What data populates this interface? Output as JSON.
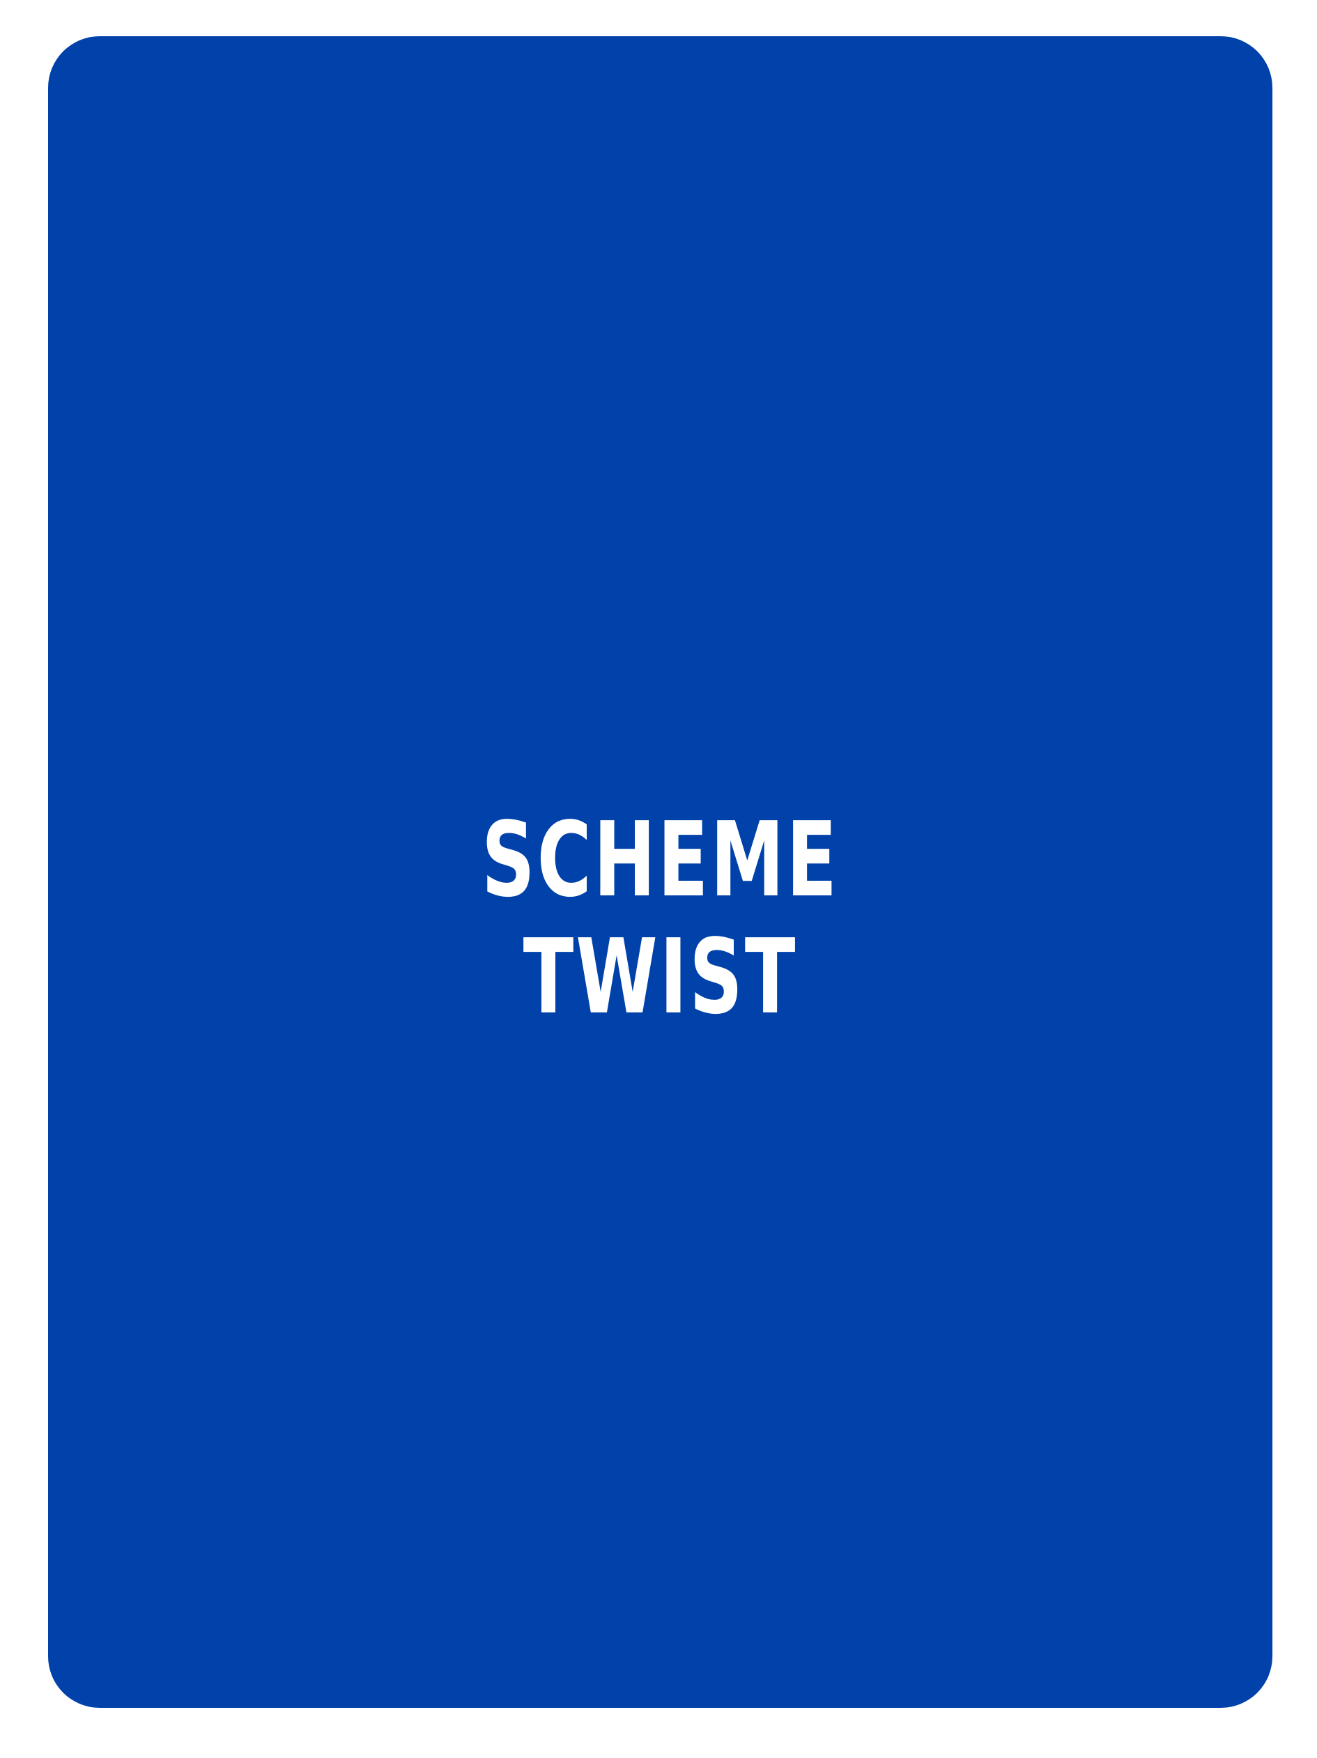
{
  "card": {
    "background_color": "#0041aa",
    "text_color": "#ffffff",
    "title_lines": [
      "SCHEME",
      "TWIST"
    ]
  }
}
